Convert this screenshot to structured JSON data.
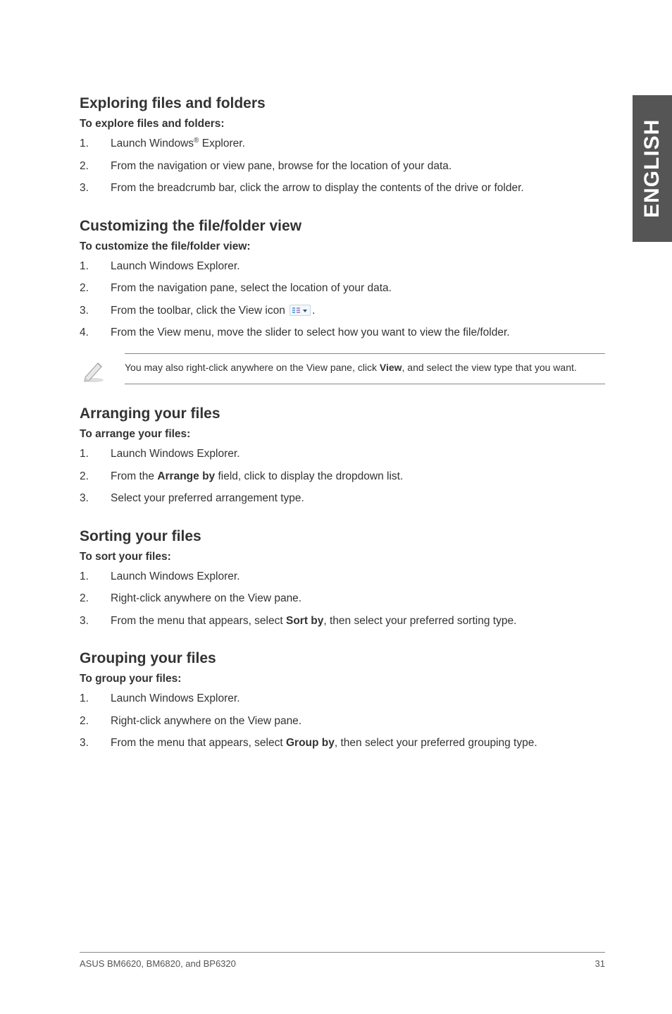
{
  "side_label": "ENGLISH",
  "sections": {
    "explore": {
      "heading": "Exploring files and folders",
      "subhead": "To explore files and folders:",
      "items": [
        {
          "num": "1.",
          "pre": "Launch Windows",
          "sup": "®",
          "post": " Explorer."
        },
        {
          "num": "2.",
          "text": "From the navigation or view pane, browse for the location of your data."
        },
        {
          "num": "3.",
          "text": "From the breadcrumb bar, click the arrow to display the contents of the drive or folder."
        }
      ]
    },
    "customize": {
      "heading": "Customizing the file/folder view",
      "subhead": "To customize the file/folder view:",
      "items": [
        {
          "num": "1.",
          "text": "Launch Windows Explorer."
        },
        {
          "num": "2.",
          "text": "From the navigation pane, select the location of your data."
        },
        {
          "num": "3.",
          "pre": "From the toolbar, click the View icon ",
          "icon": "view-icon",
          "post": "."
        },
        {
          "num": "4.",
          "text": "From the View menu, move the slider to select how you want to view the file/folder."
        }
      ],
      "note_pre": "You may also right-click anywhere on the View pane, click ",
      "note_bold": "View",
      "note_post": ", and select the view type that you want."
    },
    "arrange": {
      "heading": "Arranging your files",
      "subhead": "To arrange your files:",
      "items": [
        {
          "num": "1.",
          "text": "Launch Windows Explorer."
        },
        {
          "num": "2.",
          "pre": "From the ",
          "bold": "Arrange by",
          "post": " field, click to display the dropdown list."
        },
        {
          "num": "3.",
          "text": "Select your preferred arrangement type."
        }
      ]
    },
    "sort": {
      "heading": "Sorting your files",
      "subhead": "To sort your files:",
      "items": [
        {
          "num": "1.",
          "text": "Launch Windows Explorer."
        },
        {
          "num": "2.",
          "text": "Right-click anywhere on the View pane."
        },
        {
          "num": "3.",
          "pre": "From the menu that appears, select ",
          "bold": "Sort by",
          "post": ", then select your preferred sorting type."
        }
      ]
    },
    "group": {
      "heading": "Grouping your files",
      "subhead": "To group your files:",
      "items": [
        {
          "num": "1.",
          "text": "Launch Windows Explorer."
        },
        {
          "num": "2.",
          "text": "Right-click anywhere on the View pane."
        },
        {
          "num": "3.",
          "pre": "From the menu that appears, select ",
          "bold": "Group by",
          "post": ", then select your preferred grouping type."
        }
      ]
    }
  },
  "footer": {
    "left": "ASUS BM6620, BM6820, and BP6320",
    "right": "31"
  }
}
